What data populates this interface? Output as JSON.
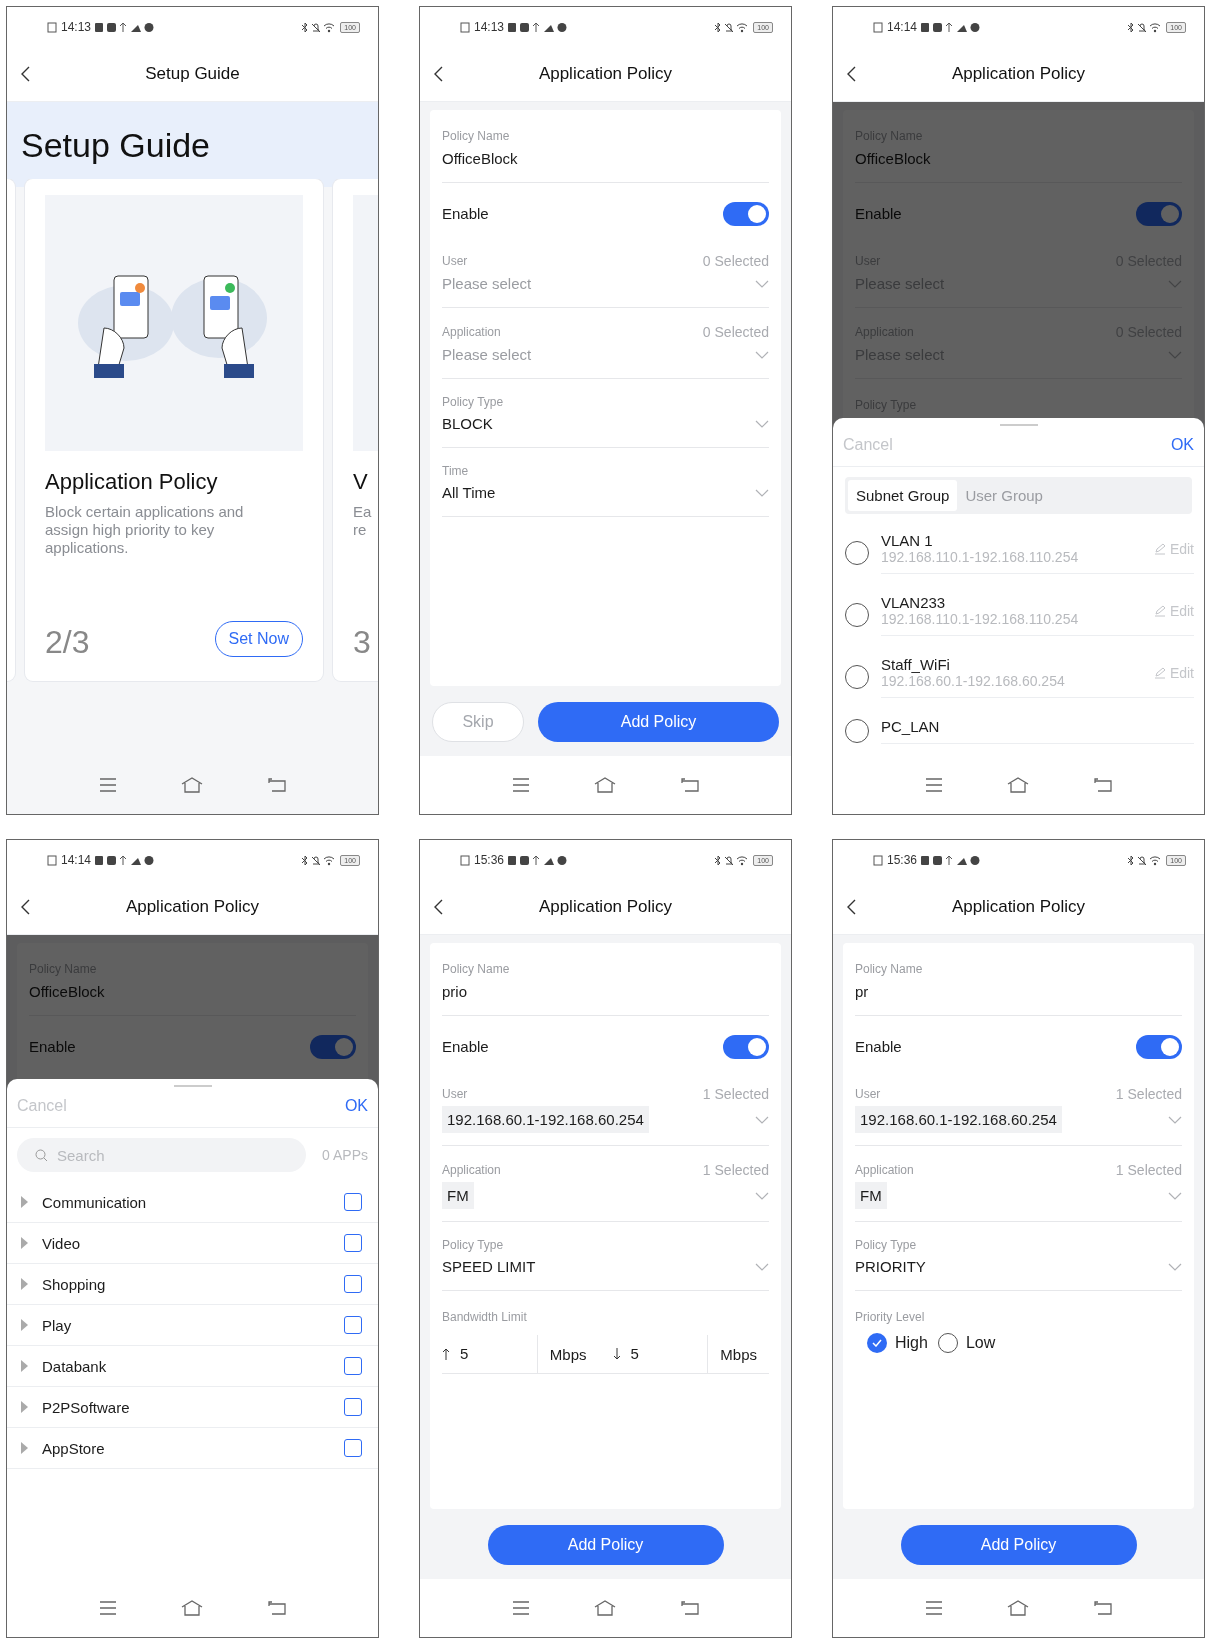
{
  "screens": [
    {
      "kind": "guide",
      "status": {
        "time": "14:13",
        "battery": "100"
      },
      "title": "Setup Guide",
      "hero": "Setup Guide",
      "card": {
        "title": "Application Policy",
        "description": "Block certain applications and assign high priority to key applications.",
        "step": "2/3",
        "button": "Set Now"
      },
      "next_card": {
        "title": "V",
        "description": [
          "Ea",
          "re"
        ],
        "step": "3"
      }
    },
    {
      "kind": "form",
      "status": {
        "time": "14:13",
        "battery": "100"
      },
      "title": "Application Policy",
      "fields": [
        {
          "kind": "text",
          "label": "Policy Name",
          "value": "OfficeBlock"
        },
        {
          "kind": "toggle",
          "label": "Enable",
          "on": true
        },
        {
          "kind": "select",
          "label": "User",
          "count": "0 Selected",
          "placeholder": "Please select"
        },
        {
          "kind": "select",
          "label": "Application",
          "count": "0 Selected",
          "placeholder": "Please select"
        },
        {
          "kind": "select",
          "label": "Policy Type",
          "value": "BLOCK"
        },
        {
          "kind": "select",
          "label": "Time",
          "value": "All Time"
        }
      ],
      "footer": [
        {
          "label": "Skip",
          "disabled": true
        },
        {
          "label": "Add Policy",
          "disabled": false
        }
      ]
    },
    {
      "kind": "form",
      "status": {
        "time": "14:14",
        "battery": "100"
      },
      "title": "Application Policy",
      "fields": [
        {
          "kind": "text",
          "label": "Policy Name",
          "value": "OfficeBlock"
        },
        {
          "kind": "toggle",
          "label": "Enable",
          "on": true
        },
        {
          "kind": "select",
          "label": "User",
          "count": "0 Selected",
          "placeholder": "Please select"
        },
        {
          "kind": "select",
          "label": "Application",
          "count": "0 Selected",
          "placeholder": "Please select"
        },
        {
          "kind": "label",
          "label": "Policy Type"
        }
      ],
      "sheet": {
        "kind": "subnet",
        "cancel": "Cancel",
        "ok": "OK",
        "tabs": [
          {
            "label": "Subnet Group",
            "selected": true
          },
          {
            "label": "User Group",
            "selected": false
          }
        ],
        "items": [
          {
            "name": "VLAN 1",
            "range": "192.168.110.1-192.168.110.254",
            "edit": "Edit",
            "selected": false
          },
          {
            "name": "VLAN233",
            "range": "192.168.110.1-192.168.110.254",
            "edit": "Edit",
            "selected": false
          },
          {
            "name": "Staff_WiFi",
            "range": "192.168.60.1-192.168.60.254",
            "edit": "Edit",
            "selected": false
          },
          {
            "name": "PC_LAN",
            "selected": false
          }
        ]
      }
    },
    {
      "kind": "form",
      "status": {
        "time": "14:14",
        "battery": "100"
      },
      "title": "Application Policy",
      "fields": [
        {
          "kind": "text",
          "label": "Policy Name",
          "value": "OfficeBlock"
        },
        {
          "kind": "toggle",
          "label": "Enable",
          "on": true
        }
      ],
      "sheet": {
        "kind": "apps",
        "cancel": "Cancel",
        "ok": "OK",
        "search_placeholder": "Search",
        "count": "0 APPs",
        "categories": [
          {
            "label": "Communication",
            "checked": false
          },
          {
            "label": "Video",
            "checked": false
          },
          {
            "label": "Shopping",
            "checked": false
          },
          {
            "label": "Play",
            "checked": false
          },
          {
            "label": "Databank",
            "checked": false
          },
          {
            "label": "P2PSoftware",
            "checked": false
          },
          {
            "label": "AppStore",
            "checked": false
          }
        ]
      }
    },
    {
      "kind": "form",
      "status": {
        "time": "15:36",
        "battery": "100"
      },
      "title": "Application Policy",
      "fields": [
        {
          "kind": "text",
          "label": "Policy Name",
          "value": "prio"
        },
        {
          "kind": "toggle",
          "label": "Enable",
          "on": true
        },
        {
          "kind": "select",
          "label": "User",
          "count": "1 Selected",
          "chip": "192.168.60.1-192.168.60.254"
        },
        {
          "kind": "select",
          "label": "Application",
          "count": "1 Selected",
          "chip": "FM"
        },
        {
          "kind": "select",
          "label": "Policy Type",
          "value": "SPEED LIMIT"
        },
        {
          "kind": "bandwidth",
          "label": "Bandwidth Limit",
          "up": {
            "value": "5",
            "unit": "Mbps"
          },
          "down": {
            "value": "5",
            "unit": "Mbps"
          }
        }
      ],
      "footer": [
        {
          "label": "Add Policy",
          "disabled": false
        }
      ]
    },
    {
      "kind": "form",
      "status": {
        "time": "15:36",
        "battery": "100"
      },
      "title": "Application Policy",
      "fields": [
        {
          "kind": "text",
          "label": "Policy Name",
          "value": "pr"
        },
        {
          "kind": "toggle",
          "label": "Enable",
          "on": true
        },
        {
          "kind": "select",
          "label": "User",
          "count": "1 Selected",
          "chip": "192.168.60.1-192.168.60.254"
        },
        {
          "kind": "select",
          "label": "Application",
          "count": "1 Selected",
          "chip": "FM"
        },
        {
          "kind": "select",
          "label": "Policy Type",
          "value": "PRIORITY"
        },
        {
          "kind": "priority",
          "label": "Priority Level",
          "options": [
            {
              "label": "High",
              "selected": true
            },
            {
              "label": "Low",
              "selected": false
            }
          ]
        }
      ],
      "footer": [
        {
          "label": "Add Policy",
          "disabled": false
        }
      ]
    }
  ]
}
